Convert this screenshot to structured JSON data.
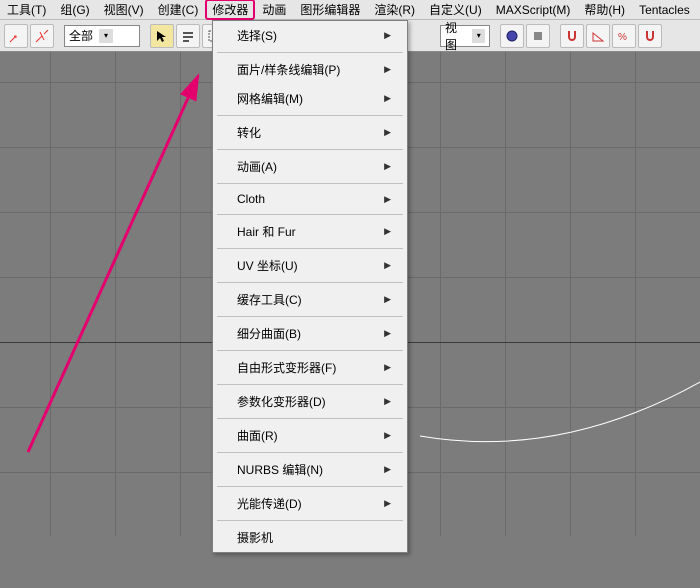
{
  "menubar": {
    "items": [
      {
        "label": "工具(T)"
      },
      {
        "label": "组(G)"
      },
      {
        "label": "视图(V)"
      },
      {
        "label": "创建(C)"
      },
      {
        "label": "修改器"
      },
      {
        "label": "动画"
      },
      {
        "label": "图形编辑器"
      },
      {
        "label": "渲染(R)"
      },
      {
        "label": "自定义(U)"
      },
      {
        "label": "MAXScript(M)"
      },
      {
        "label": "帮助(H)"
      },
      {
        "label": "Tentacles"
      }
    ],
    "active_index": 4
  },
  "toolbar": {
    "selection_filter": "全部",
    "view_label": "视图"
  },
  "dropdown": {
    "items": [
      {
        "label": "选择(S)",
        "sub": true
      },
      {
        "sep": true
      },
      {
        "label": "面片/样条线编辑(P)",
        "sub": true
      },
      {
        "label": "网格编辑(M)",
        "sub": true
      },
      {
        "sep": true
      },
      {
        "label": "转化",
        "sub": true
      },
      {
        "sep": true
      },
      {
        "label": "动画(A)",
        "sub": true
      },
      {
        "sep": true
      },
      {
        "label": "Cloth",
        "sub": true
      },
      {
        "sep": true
      },
      {
        "label": "Hair 和 Fur",
        "sub": true
      },
      {
        "sep": true
      },
      {
        "label": "UV 坐标(U)",
        "sub": true
      },
      {
        "sep": true
      },
      {
        "label": "缓存工具(C)",
        "sub": true
      },
      {
        "sep": true
      },
      {
        "label": "细分曲面(B)",
        "sub": true
      },
      {
        "sep": true
      },
      {
        "label": "自由形式变形器(F)",
        "sub": true
      },
      {
        "sep": true
      },
      {
        "label": "参数化变形器(D)",
        "sub": true
      },
      {
        "sep": true
      },
      {
        "label": "曲面(R)",
        "sub": true
      },
      {
        "sep": true
      },
      {
        "label": "NURBS 编辑(N)",
        "sub": true
      },
      {
        "sep": true
      },
      {
        "label": "光能传递(D)",
        "sub": true
      },
      {
        "sep": true
      },
      {
        "label": "摄影机",
        "sub": false
      }
    ]
  }
}
